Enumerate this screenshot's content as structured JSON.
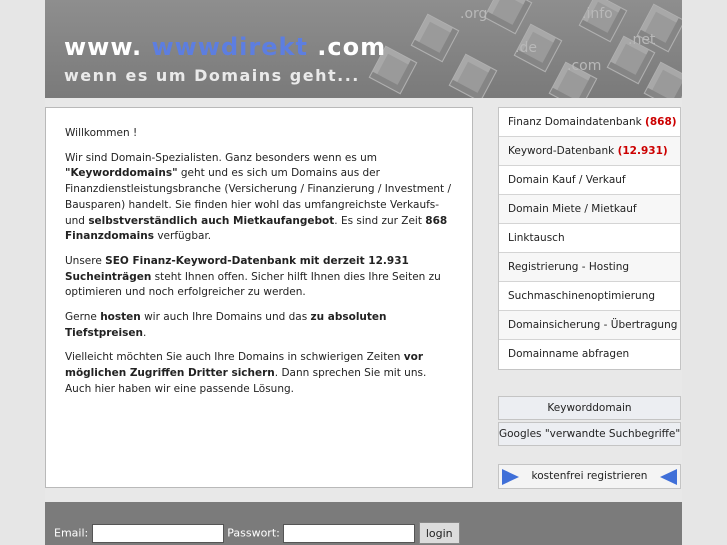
{
  "header": {
    "title_prefix": "www. ",
    "title_accent": "wwwdirekt",
    "title_suffix": " .com",
    "subtitle": "wenn es um Domains geht...",
    "tlds": [
      ".org",
      ".info",
      ".net",
      ".de",
      ".com"
    ]
  },
  "content": {
    "greeting": "Willkommen !",
    "p1": {
      "a": "Wir sind Domain-Spezialisten. Ganz besonders wenn es um ",
      "b": "\"Keyworddomains\"",
      "c": " geht und es sich um Domains aus der Finanzdienstleistungsbranche (Versicherung / Finanzierung / Investment / Bausparen) handelt. Sie finden hier wohl das umfangreichste Verkaufs- und ",
      "d": "selbstverständlich auch Mietkaufangebot",
      "e": ". Es sind zur Zeit ",
      "f": "868 Finanzdomains",
      "g": " verfügbar."
    },
    "p2": {
      "a": "Unsere ",
      "b": "SEO Finanz-Keyword-Datenbank mit derzeit 12.931 Sucheinträgen",
      "c": " steht Ihnen offen. Sicher hilft Ihnen dies Ihre Seiten zu optimieren und noch erfolgreicher zu werden."
    },
    "p3": {
      "a": "Gerne ",
      "b": "hosten",
      "c": " wir auch Ihre Domains und das ",
      "d": "zu absoluten Tiefstpreisen",
      "e": "."
    },
    "p4": {
      "a": "Vielleicht möchten Sie auch Ihre Domains in schwierigen Zeiten ",
      "b": "vor möglichen Zugriffen Dritter sichern",
      "c": ". Dann sprechen Sie mit uns. Auch hier haben wir eine passende Lösung."
    }
  },
  "nav": {
    "items": [
      {
        "label": "Finanz Domaindatenbank",
        "count": "(868)"
      },
      {
        "label": "Keyword-Datenbank",
        "count": "(12.931)"
      },
      {
        "label": "Domain Kauf / Verkauf",
        "count": ""
      },
      {
        "label": "Domain Miete / Mietkauf",
        "count": ""
      },
      {
        "label": "Linktausch",
        "count": ""
      },
      {
        "label": "Registrierung - Hosting",
        "count": ""
      },
      {
        "label": "Suchmaschinenoptimierung",
        "count": ""
      },
      {
        "label": "Domainsicherung - Übertragung",
        "count": ""
      },
      {
        "label": "Domainname abfragen",
        "count": ""
      }
    ]
  },
  "side": {
    "keyword_domain": "Keyworddomain",
    "google_related": "Googles \"verwandte Suchbegriffe\"",
    "register": "kostenfrei registrieren"
  },
  "login": {
    "email_label": "Email:",
    "email_value": "",
    "password_label": "Passwort:",
    "password_value": "",
    "button": "login"
  },
  "colors": {
    "accent_blue": "#5d7ee0",
    "count_red": "#cc0000",
    "header_gray": "#7a7a7a",
    "footer_gray": "#7b7b7b",
    "arrow_blue": "#3f6fd8"
  }
}
